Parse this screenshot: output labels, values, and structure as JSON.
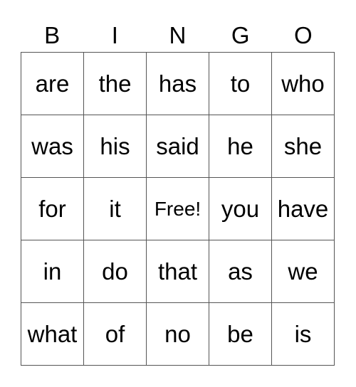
{
  "header": [
    "B",
    "I",
    "N",
    "G",
    "O"
  ],
  "cells": [
    [
      "are",
      "the",
      "has",
      "to",
      "who"
    ],
    [
      "was",
      "his",
      "said",
      "he",
      "she"
    ],
    [
      "for",
      "it",
      "Free!",
      "you",
      "have"
    ],
    [
      "in",
      "do",
      "that",
      "as",
      "we"
    ],
    [
      "what",
      "of",
      "no",
      "be",
      "is"
    ]
  ]
}
